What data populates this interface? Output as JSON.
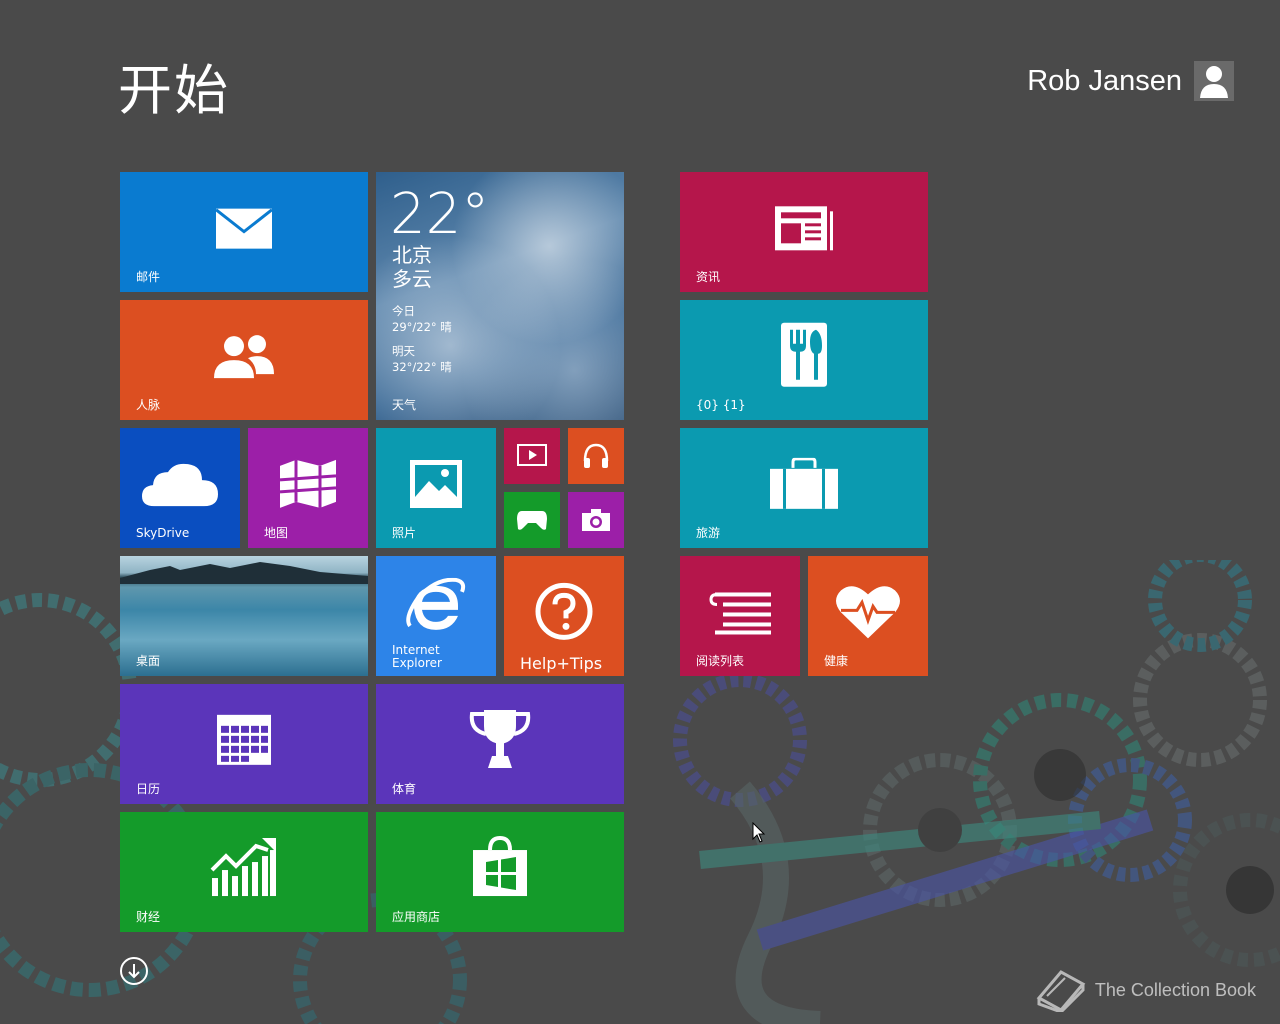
{
  "header": {
    "title": "开始",
    "user_name": "Rob Jansen"
  },
  "tiles": {
    "mail": {
      "label": "邮件",
      "icon": "mail-icon",
      "color": "#0a7bd0"
    },
    "people": {
      "label": "人脉",
      "icon": "people-icon",
      "color": "#dc4f21"
    },
    "weather": {
      "label": "天气",
      "temperature": "22°",
      "city": "北京",
      "condition": "多云",
      "today_label": "今日",
      "today_forecast": "29°/22° 晴",
      "tomorrow_label": "明天",
      "tomorrow_forecast": "32°/22° 晴"
    },
    "skydrive": {
      "label": "SkyDrive",
      "icon": "cloud-icon",
      "color": "#0a4ec0"
    },
    "maps": {
      "label": "地图",
      "icon": "map-icon",
      "color": "#9c1fa8"
    },
    "photos": {
      "label": "照片",
      "icon": "photo-icon",
      "color": "#0b9ab0"
    },
    "video": {
      "icon": "video-icon",
      "color": "#b5164b"
    },
    "music": {
      "icon": "headphones-icon",
      "color": "#dc4f21"
    },
    "games": {
      "icon": "gamepad-icon",
      "color": "#149b2a"
    },
    "camera": {
      "icon": "camera-icon",
      "color": "#9c1fa8"
    },
    "desktop": {
      "label": "桌面"
    },
    "ie": {
      "label_line1": "Internet",
      "label_line2": "Explorer",
      "icon": "ie-icon",
      "color": "#2d84e8"
    },
    "help": {
      "label": "Help+Tips",
      "icon": "help-icon",
      "color": "#dc4f21"
    },
    "calendar": {
      "label": "日历",
      "icon": "calendar-icon",
      "color": "#5b35ba"
    },
    "sports": {
      "label": "体育",
      "icon": "trophy-icon",
      "color": "#5b35ba"
    },
    "finance": {
      "label": "财经",
      "icon": "chart-icon",
      "color": "#149b2a"
    },
    "store": {
      "label": "应用商店",
      "icon": "store-icon",
      "color": "#149b2a"
    },
    "news": {
      "label": "资讯",
      "icon": "news-icon",
      "color": "#b5164b"
    },
    "food": {
      "label": "{0} {1}",
      "icon": "fork-knife-icon",
      "color": "#0b9ab0"
    },
    "travel": {
      "label": "旅游",
      "icon": "suitcase-icon",
      "color": "#0b9ab0"
    },
    "reading": {
      "label": "阅读列表",
      "icon": "reading-list-icon",
      "color": "#b5164b"
    },
    "health": {
      "label": "健康",
      "icon": "heart-icon",
      "color": "#dc4f21"
    }
  },
  "footer": {
    "watermark": "The Collection Book"
  }
}
